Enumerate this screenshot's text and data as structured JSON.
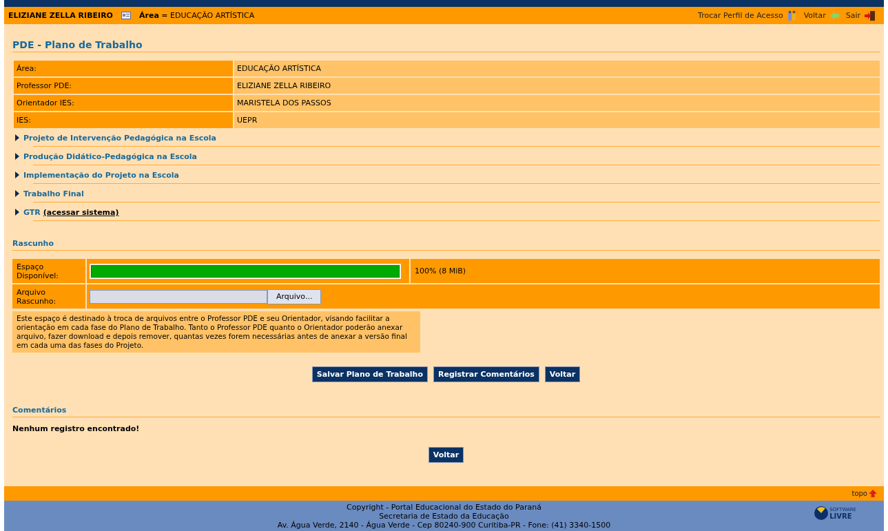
{
  "topbar": {
    "user": "ELIZIANE ZELLA RIBEIRO",
    "area": "**Área** = EDUCAÇÃO ARTÍSTICA",
    "links": [
      {
        "label": "Trocar Perfil de Acesso",
        "kind": "profile"
      },
      {
        "label": "Voltar",
        "kind": "back"
      },
      {
        "label": "Sair",
        "kind": "exit"
      }
    ]
  },
  "title": "PDE - Plano de Trabalho",
  "info_rows": [
    {
      "label": "Área:",
      "value": "EDUCAÇÃO ARTÍSTICA"
    },
    {
      "label": "Professor PDE:",
      "value": "ELIZIANE ZELLA RIBEIRO"
    },
    {
      "label": "Orientador IES:",
      "value": "MARISTELA DOS PASSOS"
    },
    {
      "label": "IES:",
      "value": "UEPR"
    }
  ],
  "sections": [
    {
      "label": "Projeto de Intervenção Pedagógica na Escola"
    },
    {
      "label": "Produção Didático-Pedagógica na Escola"
    },
    {
      "label": "Implementação do Projeto na Escola"
    },
    {
      "label": "Trabalho Final"
    },
    {
      "label": "GTR",
      "extra_link": "(acessar sistema)"
    }
  ],
  "draft": {
    "heading": "Rascunho",
    "space_label": "Espaço Disponível:",
    "level": 1.0,
    "space_reading": "100% (8 MiB)",
    "file_label": "Arquivo Rascunho:",
    "file_button": "Arquivo...",
    "note": "Este espaço é destinado à troca de arquivos entre o Professor PDE e seu Orientador, visando facilitar a orientação em cada fase do Plano de Trabalho. Tanto o Professor PDE quanto o Orientador poderão anexar arquivo, fazer download e depois remover, quantas vezes forem necessárias antes de anexar a versão final em cada uma das fases do Projeto."
  },
  "buttons": [
    "Salvar Plano de Trabalho",
    "Registrar Comentários",
    "Voltar"
  ],
  "comments": {
    "heading": "Comentários",
    "empty": "Nenhum registro encontrado!",
    "button": "Voltar"
  },
  "top_link": "topo",
  "footer": {
    "lines": [
      "Copyright - Portal Educacional do Estado do Paraná",
      "Secretaria de Estado da Educação",
      "Av. Água Verde, 2140 - Água Verde - Cep 80240-900 Curitiba-PR - Fone: (41) 3340-1500"
    ],
    "logo_small": "SOFTWARE",
    "logo_big": "LIVRE"
  }
}
